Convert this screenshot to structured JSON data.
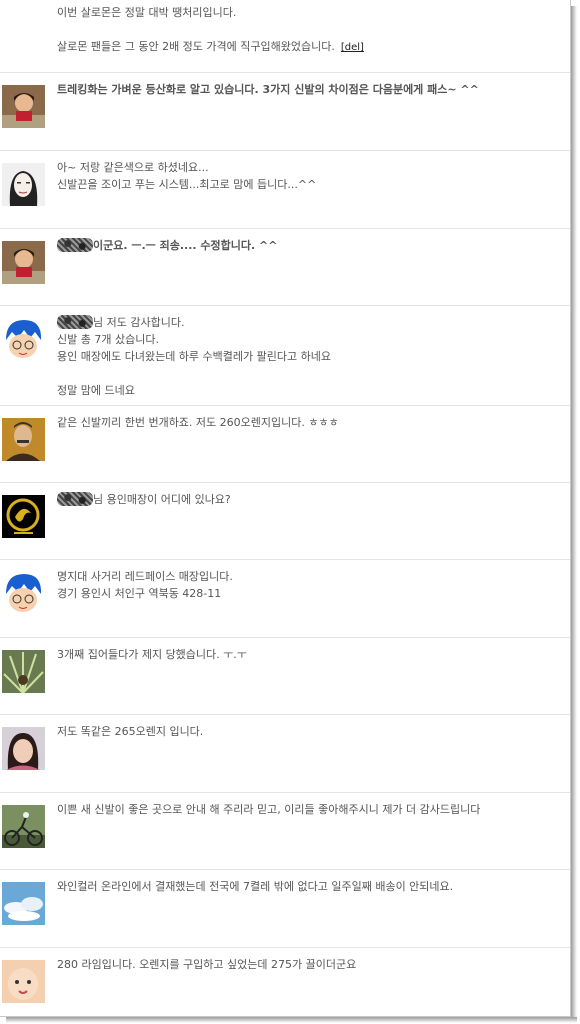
{
  "comments": [
    {
      "avatar": "none",
      "text": "이번 살로몬은 정말 대박 땡처리입니다.\n\n살로몬 팬들은 그 동안 2배 정도 가격에 직구입해왔었습니다.",
      "del": "[del]"
    },
    {
      "avatar": "woman-photo-icon",
      "bold": true,
      "text": "트레킹화는 가벼운 등산화로 알고 있습니다. 3가지 신발의 차이점은 다음분에게 패스~ ^^"
    },
    {
      "avatar": "woman-sketch-icon",
      "text": "아~ 저랑 같은색으로 하셨네요...\n신발끈을 조이고 푸는 시스템...최고로 맘에 듭니다...^^"
    },
    {
      "avatar": "woman-photo-icon",
      "bold": true,
      "text": "이군요. ㅡ.ㅡ 죄송.... 수정합니다. ^^"
    },
    {
      "avatar": "cartoon-boy-icon",
      "text": "님 저도 감사합니다.\n신발 총 7개 샀습니다.\n용인 매장에도 다녀왔는데 하루 수백켤레가 팔린다고 하네요\n\n정말 맘에 드네요"
    },
    {
      "avatar": "old-man-portrait-icon",
      "text": "같은 신발끼리 한번 번개하죠. 저도 260오렌지입니다. ㅎㅎㅎ"
    },
    {
      "avatar": "gold-emblem-icon",
      "text": "님 용인매장이 어디에 있나요?"
    },
    {
      "avatar": "cartoon-boy-icon",
      "text": "명지대 사거리 레드페이스 매장입니다.\n경기 용인시 처인구 역북동 428-11"
    },
    {
      "avatar": "plant-photo-icon",
      "text": "3개째 집어들다가 제지 당했습니다. ㅜ.ㅜ"
    },
    {
      "avatar": "girl-photo-icon",
      "text": "저도 똑같은 265오렌지 입니다."
    },
    {
      "avatar": "cyclist-photo-icon",
      "text": "이쁜 새 신발이 좋은 곳으로 안내 해 주리라 믿고, 이리들 좋아해주시니 제가 더 감사드립니다"
    },
    {
      "avatar": "sky-photo-icon",
      "text": "와인컬러 온라인에서 결재했는데 전국에 7켤레 밖에 없다고 일주일째 배송이 안되네요."
    },
    {
      "avatar": "baby-face-icon",
      "text": "280 라임입니다. 오렌지를 구입하고 싶었는데 275가 끌이더군요"
    }
  ]
}
